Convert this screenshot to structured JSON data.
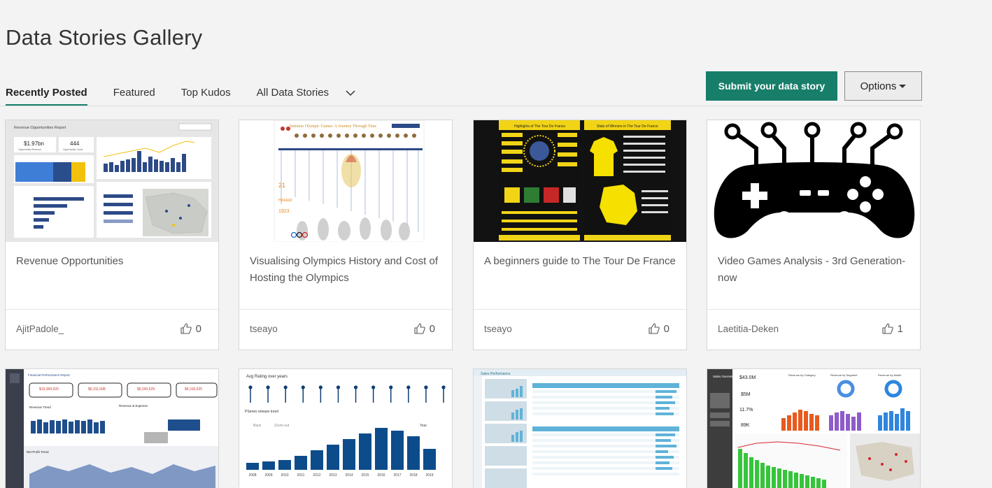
{
  "page": {
    "title": "Data Stories Gallery"
  },
  "tabs": [
    {
      "label": "Recently Posted"
    },
    {
      "label": "Featured"
    },
    {
      "label": "Top Kudos"
    },
    {
      "label": "All Data Stories"
    }
  ],
  "actions": {
    "submit_label": "Submit your data story",
    "options_label": "Options"
  },
  "cards": [
    {
      "title": "Revenue Opportunities",
      "author": "AjitPadole_",
      "kudos": "0",
      "thumb": {
        "report_title": "Revenue Opportunities Report",
        "kpi1": "$1.97bn",
        "kpi1_label": "Opportunity Revenue",
        "kpi2": "444",
        "kpi2_label": "Opportunity Count"
      }
    },
    {
      "title": "Visualising Olympics History and Cost of Hosting the Olympics",
      "author": "tseayo",
      "kudos": "0",
      "thumb": {
        "heading": "Summer Olympic Games: A Journey Through Time"
      }
    },
    {
      "title": "A beginners guide to The Tour De France",
      "author": "tseayo",
      "kudos": "0",
      "thumb": {
        "heading1": "Highlights of The Tour De France",
        "heading2": "Stats of Winners in The Tour De France"
      }
    },
    {
      "title": "Video Games Analysis - 3rd Generation-now",
      "author": "Laetitia-Deken",
      "kudos": "1",
      "thumb": {}
    },
    {
      "title": "",
      "author": "",
      "kudos": "",
      "thumb": {
        "heading": "Financial Performance Report",
        "v1": "$19,359,520",
        "v2": "$6,311,508",
        "v3": "$9,243,529",
        "v4": "$4,316,025",
        "chart1": "Revenue Trend",
        "chart2": "Revenue & Expense",
        "chart3": "Net Profit Trend"
      }
    },
    {
      "title": "",
      "author": "",
      "kudos": "",
      "thumb": {
        "heading": "Avg Rating over years",
        "sub": "PSeries release trend",
        "back": "Back",
        "zoom": "Zoom out",
        "year": "Year",
        "years": [
          "2008",
          "2009",
          "2010",
          "2011",
          "2012",
          "2013",
          "2014",
          "2015",
          "2016",
          "2017",
          "2018",
          "2019"
        ]
      }
    },
    {
      "title": "",
      "author": "",
      "kudos": "",
      "thumb": {
        "heading": "Sales Performance"
      }
    },
    {
      "title": "",
      "author": "",
      "kudos": "",
      "thumb": {
        "heading": "Sales Overview",
        "k1": "$43.0M",
        "k2": "$5M",
        "k3": "11.7%",
        "k4": "89K",
        "c1": "Revenue by Category",
        "c2": "Revenue by Segment",
        "c3": "Revenue by Model"
      }
    }
  ],
  "colors": {
    "accent": "#177e6a",
    "navy": "#2c4a86",
    "olympic_bg": "#ffffff",
    "tour_yellow": "#f1d416"
  }
}
